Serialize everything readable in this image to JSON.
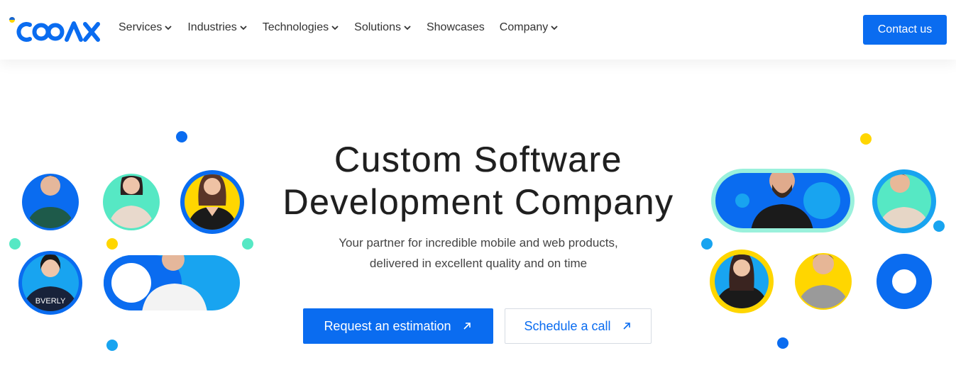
{
  "brand": {
    "logo_text": "COAX",
    "colors": {
      "primary": "#0a6cf0",
      "sky": "#18a4f0",
      "mint": "#56e8c4",
      "yellow": "#ffd600",
      "text": "#1f1f1f"
    }
  },
  "nav": {
    "items": [
      {
        "label": "Services",
        "has_dropdown": true
      },
      {
        "label": "Industries",
        "has_dropdown": true
      },
      {
        "label": "Technologies",
        "has_dropdown": true
      },
      {
        "label": "Solutions",
        "has_dropdown": true
      },
      {
        "label": "Showcases",
        "has_dropdown": false
      },
      {
        "label": "Company",
        "has_dropdown": true
      }
    ],
    "contact_label": "Contact us"
  },
  "hero": {
    "title_line1": "Custom Software",
    "title_line2": "Development Company",
    "subtitle_line1": "Your partner for incredible mobile and web products,",
    "subtitle_line2": "delivered in excellent quality and on time",
    "primary_cta": "Request an estimation",
    "secondary_cta": "Schedule a call"
  }
}
